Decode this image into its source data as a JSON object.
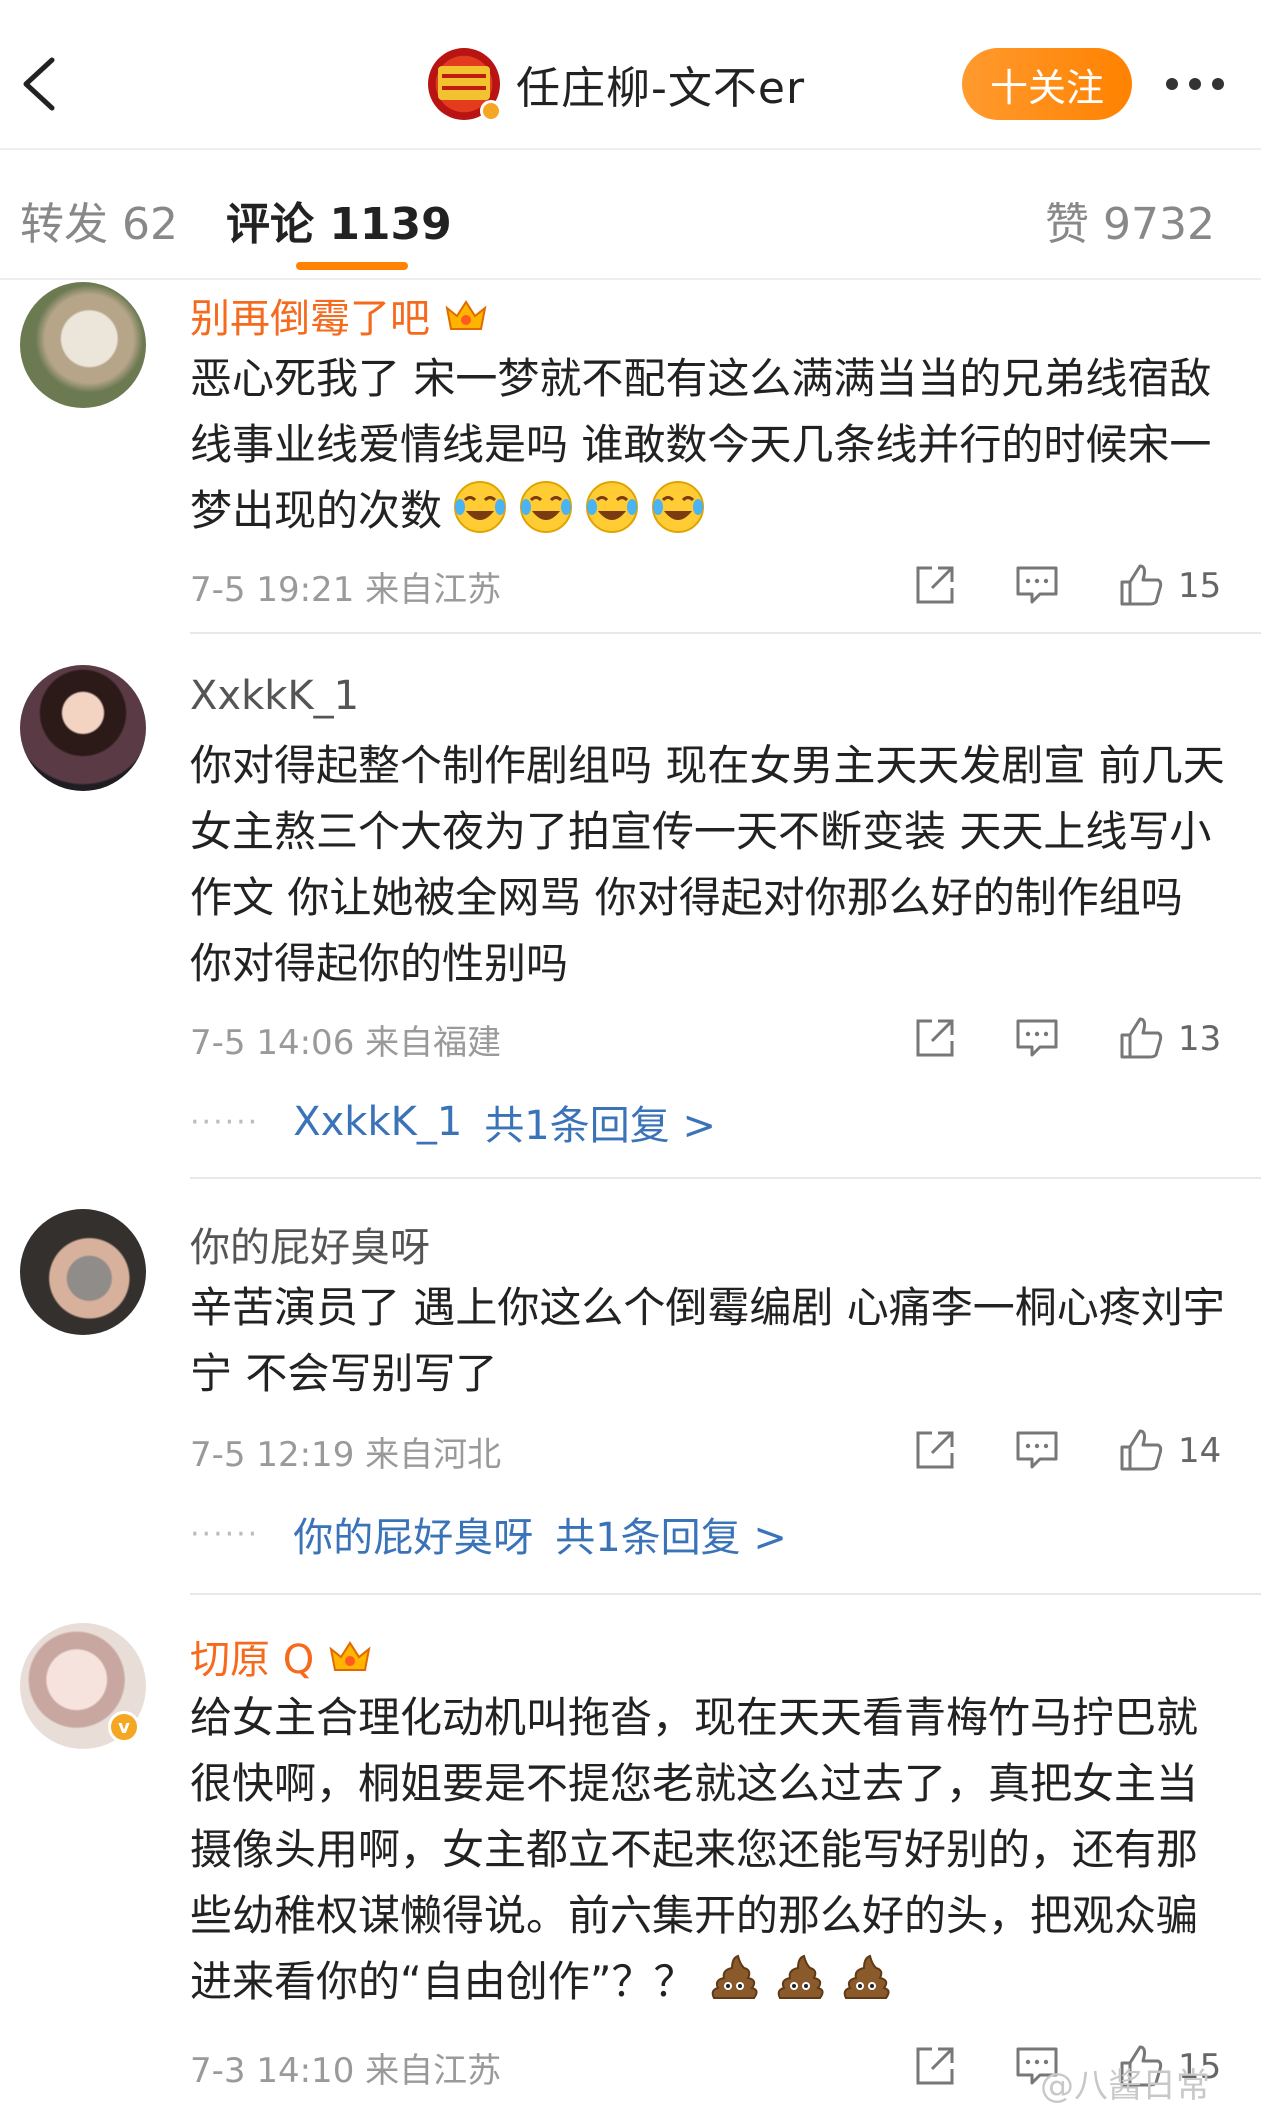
{
  "header": {
    "back_icon": "chevron-left-icon",
    "title": "任庄柳-文不er",
    "follow_label": "十关注",
    "accent": "#ff8200"
  },
  "tabs": {
    "repost": "转发 62",
    "comments": "评论 1139",
    "likes": "赞 9732"
  },
  "comments": [
    {
      "username": "别再倒霉了吧",
      "vip": true,
      "text": "恶心死我了 宋一梦就不配有这么满满当当的兄弟线宿敌线事业线爱情线是吗 谁敢数今天几条线并行的时候宋一梦出现的次数",
      "emojis": [
        "laughing-crying",
        "laughing-crying",
        "laughing-crying",
        "laughing-crying"
      ],
      "meta": "7-5 19:21 来自江苏",
      "likes": "15"
    },
    {
      "username": "XxkkK_1",
      "vip": false,
      "text": "你对得起整个制作剧组吗 现在女男主天天发剧宣 前几天女主熬三个大夜为了拍宣传一天不断变装 天天上线写小作文 你让她被全网骂 你对得起对你那么好的制作组吗 你对得起你的性别吗",
      "meta": "7-5 14:06 来自福建",
      "likes": "13",
      "reply_name": "XxkkK_1",
      "reply_count": "共1条回复 >"
    },
    {
      "username": "你的屁好臭呀",
      "vip": false,
      "text": "辛苦演员了 遇上你这么个倒霉编剧 心痛李一桐心疼刘宇宁 不会写别写了",
      "meta": "7-5 12:19 来自河北",
      "likes": "14",
      "reply_name": "你的屁好臭呀",
      "reply_count": "共1条回复 >"
    },
    {
      "username": "切原 Q",
      "vip": true,
      "text": "给女主合理化动机叫拖沓，现在天天看青梅竹马拧巴就很快啊，桐姐要是不提您老就这么过去了，真把女主当摄像头用啊，女主都立不起来您还能写好别的，还有那些幼稚权谋懒得说。前六集开的那么好的头，把观众骗进来看你的“自由创作”？？",
      "emojis": [
        "poop",
        "poop",
        "poop"
      ],
      "meta": "7-3 14:10 来自江苏",
      "likes": "15"
    }
  ],
  "watermark": "@八酱日常"
}
